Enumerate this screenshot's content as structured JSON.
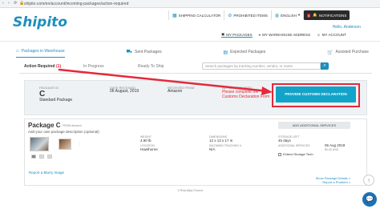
{
  "browser": {
    "url": "shipito.com/en/account/incoming-packages/action-required"
  },
  "header": {
    "logo": "Shipito",
    "top_links": [
      {
        "label": "SHIPPING CALCULATOR",
        "icon": "calculator-icon"
      },
      {
        "label": "PROHIBITED ITEMS",
        "icon": "prohibited-icon"
      },
      {
        "label": "ENGLISH",
        "icon": "globe-icon"
      }
    ],
    "notifications": {
      "label": "NOTIFICATIONS",
      "count": "4"
    },
    "hello": "Hello, Anderson",
    "my_account": "MY ACCOUNT",
    "nav": [
      {
        "label": "MY PACKAGES",
        "icon": "package-icon"
      },
      {
        "label": "MY WAREHOUSE ADDRESS",
        "icon": "location-pin-icon"
      }
    ]
  },
  "package_tabs": [
    {
      "label": "Packages in Warehouse",
      "icon": "warehouse-icon"
    },
    {
      "label": "Sent Packages",
      "icon": "truck-icon"
    },
    {
      "label": "Expected Packages",
      "icon": "calendar-icon"
    },
    {
      "label": "Assisted Purchase",
      "icon": "cart-icon"
    }
  ],
  "status_tabs": {
    "action_required": "Action Required",
    "action_required_count": "(1)",
    "in_progress": "In Progress",
    "ready_to_ship": "Ready To Ship",
    "search_placeholder": "Search packages by tracking number, vendor, or name"
  },
  "package_summary": {
    "package_id_label": "PACKAGE ID",
    "package_id": "C",
    "package_type": "Standard Package",
    "date_received_label": "DATE RECEIVED",
    "date_received": "06 August, 2019",
    "received_from_label": "RECEIVED FROM",
    "received_from": "Amazon",
    "action_required_label": "ACTION REQUIRED",
    "action_required_text": "Please complete the Customs Declaration Form",
    "customs_button": "PROVIDE CUSTOMS DECLARATION"
  },
  "package_detail": {
    "title": "Package C",
    "subtitle": "FROM Amazon",
    "desc_prompt": "Add your own package description (optional)",
    "add_services": "ADD ADDITIONAL SERVICES",
    "weight_label": "WEIGHT",
    "weight": "4.90 lb",
    "dimensions_label": "DIMENSIONS",
    "dimensions": "12 x 13 x 17 in",
    "storage_label": "STORAGE LEFT",
    "storage": "45 days",
    "location_label": "LOCATION",
    "location": "Hawthorne",
    "tracking_label": "INCOMING TRACKING #",
    "tracking": "N/A",
    "additional_label": "ADDITIONAL SERVICES",
    "additional": "Extend Storage Term",
    "extend_date": "06 Aug 2019",
    "extend_price": "$0.00 USD",
    "report": "Report a Blurry Image",
    "show_details": "Show Package Details »",
    "report_problem": "Report a Problem »"
  },
  "results": "1 Result(s) Found"
}
